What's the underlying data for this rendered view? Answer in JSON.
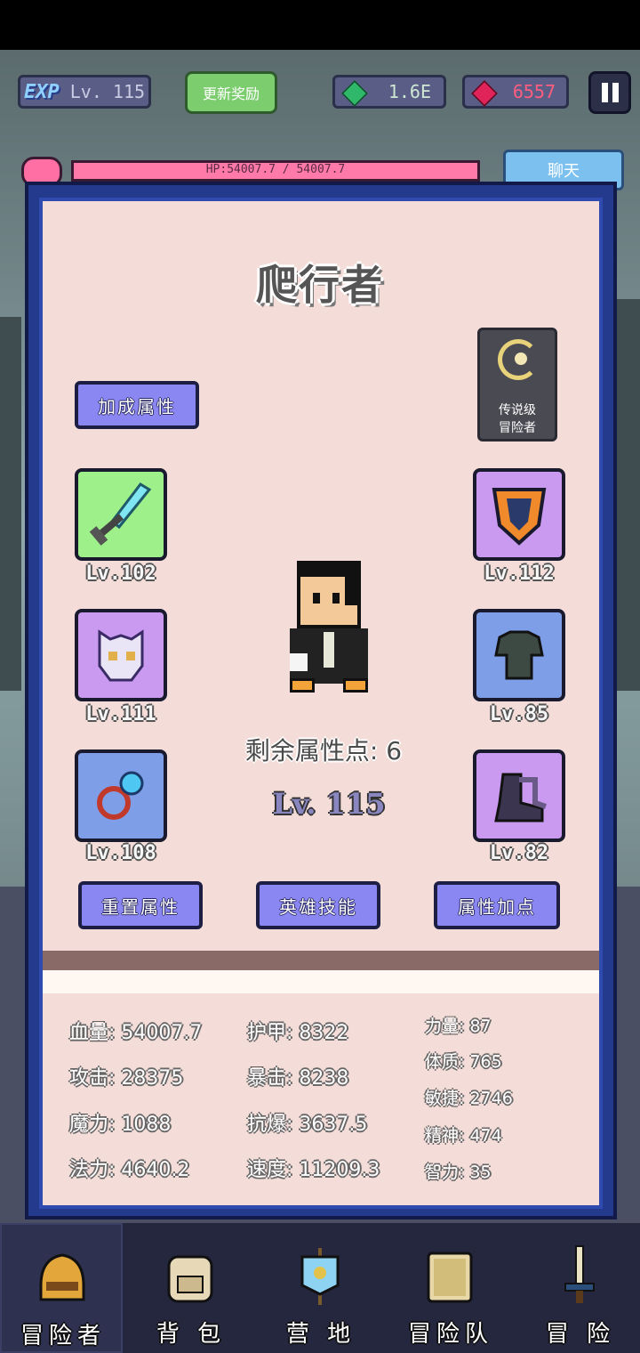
{
  "hud": {
    "exp_tag": "EXP",
    "player_level": "Lv. 115",
    "update_reward_label": "更新奖励",
    "gems": "1.6E",
    "rubies": "6557",
    "hp_text": "HP:54007.7 / 54007.7",
    "chat_label": "聊天"
  },
  "hero": {
    "name": "爬行者",
    "rank_line1": "传说级",
    "rank_line2": "冒险者",
    "remaining_points": "剩余属性点: 6",
    "level": "Lv. 115"
  },
  "buttons": {
    "bonus_attributes": "加成属性",
    "reset_attributes": "重置属性",
    "hero_skills": "英雄技能",
    "add_attributes": "属性加点"
  },
  "equipment": [
    {
      "slot": "weapon",
      "icon": "sword-icon",
      "level": "Lv.102",
      "rarity_color": "#9ef08a"
    },
    {
      "slot": "helmet",
      "icon": "skull-mask-icon",
      "level": "Lv.111",
      "rarity_color": "#c99af0"
    },
    {
      "slot": "ring",
      "icon": "ring-icon",
      "level": "Lv.108",
      "rarity_color": "#7f9ee8"
    },
    {
      "slot": "shield",
      "icon": "shield-icon",
      "level": "Lv.112",
      "rarity_color": "#c99af0"
    },
    {
      "slot": "armor",
      "icon": "armor-icon",
      "level": "Lv.85",
      "rarity_color": "#7f9ee8"
    },
    {
      "slot": "boots",
      "icon": "boots-icon",
      "level": "Lv.82",
      "rarity_color": "#c99af0"
    }
  ],
  "stats": {
    "hp": "血量: 54007.7",
    "attack": "攻击: 28375",
    "magic": "魔力: 1088",
    "spell": "法力: 4640.2",
    "armor": "护甲: 8322",
    "crit": "暴击: 8238",
    "crit_resist": "抗爆: 3637.5",
    "speed": "速度: 11209.3",
    "strength": "力量: 87",
    "constitution": "体质: 765",
    "agility": "敏捷: 2746",
    "spirit": "精神: 474",
    "intelligence": "智力: 35"
  },
  "nav": [
    {
      "label": "冒险者",
      "icon": "helmet-icon"
    },
    {
      "label": "背 包",
      "icon": "backpack-icon"
    },
    {
      "label": "营 地",
      "icon": "banner-icon"
    },
    {
      "label": "冒险队",
      "icon": "book-icon"
    },
    {
      "label": "冒 险",
      "icon": "sword-icon"
    }
  ]
}
